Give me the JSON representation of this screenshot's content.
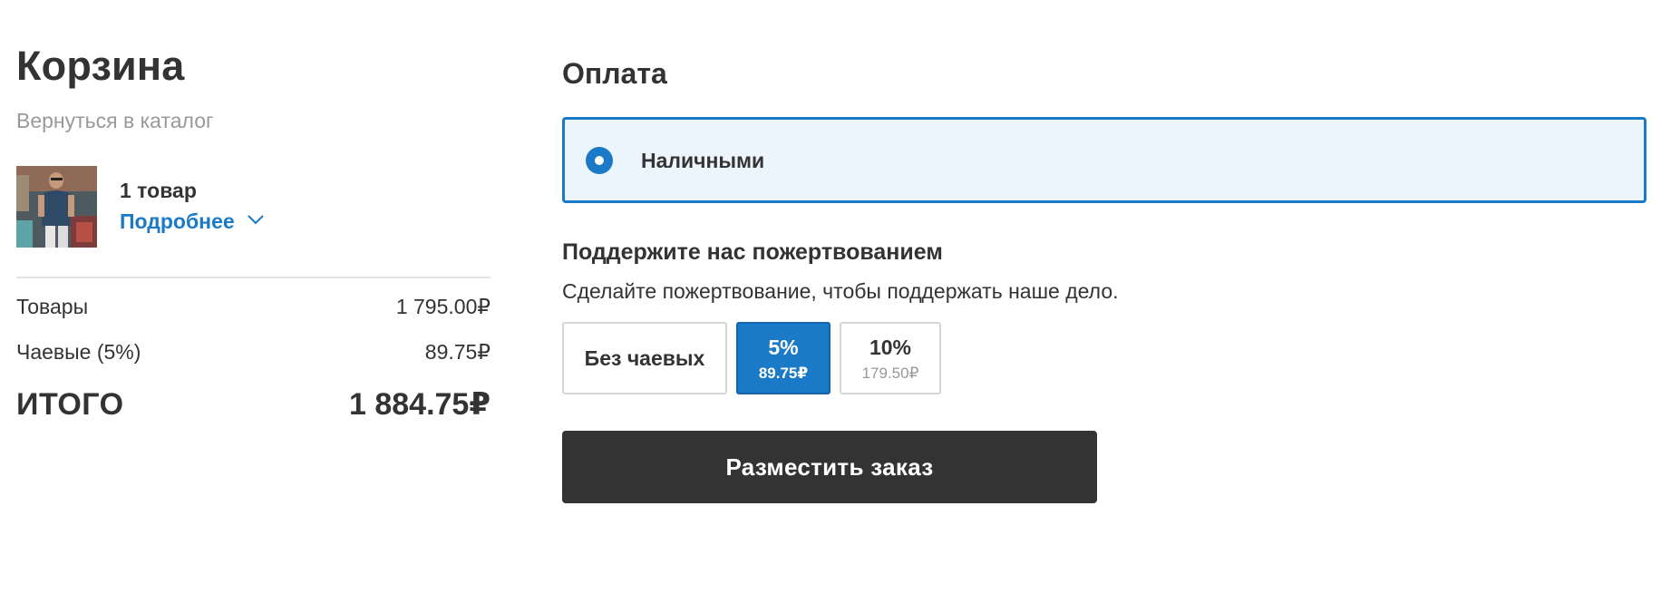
{
  "cart": {
    "title": "Корзина",
    "back_link": "Вернуться в каталог",
    "item": {
      "count_label": "1 товар",
      "details_label": "Подробнее"
    },
    "summary": {
      "goods_label": "Товары",
      "goods_value": "1 795.00₽",
      "tips_label": "Чаевые (5%)",
      "tips_value": "89.75₽",
      "total_label": "ИТОГО",
      "total_value": "1 884.75₽"
    }
  },
  "payment": {
    "title": "Оплата",
    "option_label": "Наличными",
    "option_selected": true
  },
  "donation": {
    "title": "Поддержите нас пожертвованием",
    "description": "Сделайте пожертвование, чтобы поддержать наше дело.",
    "options": [
      {
        "label": "Без чаевых",
        "selected": false
      },
      {
        "percent": "5%",
        "amount": "89.75₽",
        "selected": true
      },
      {
        "percent": "10%",
        "amount": "179.50₽",
        "selected": false
      }
    ]
  },
  "actions": {
    "place_order_label": "Разместить заказ"
  },
  "colors": {
    "accent": "#1a7ac7",
    "selected_bg": "#edf5fc",
    "button_dark": "#333333",
    "muted_text": "#999999",
    "divider": "#e3e3e3"
  },
  "icons": {
    "radio": "radio-selected-icon",
    "chevron": "chevron-down-icon",
    "thumbnail": "product-thumbnail"
  }
}
